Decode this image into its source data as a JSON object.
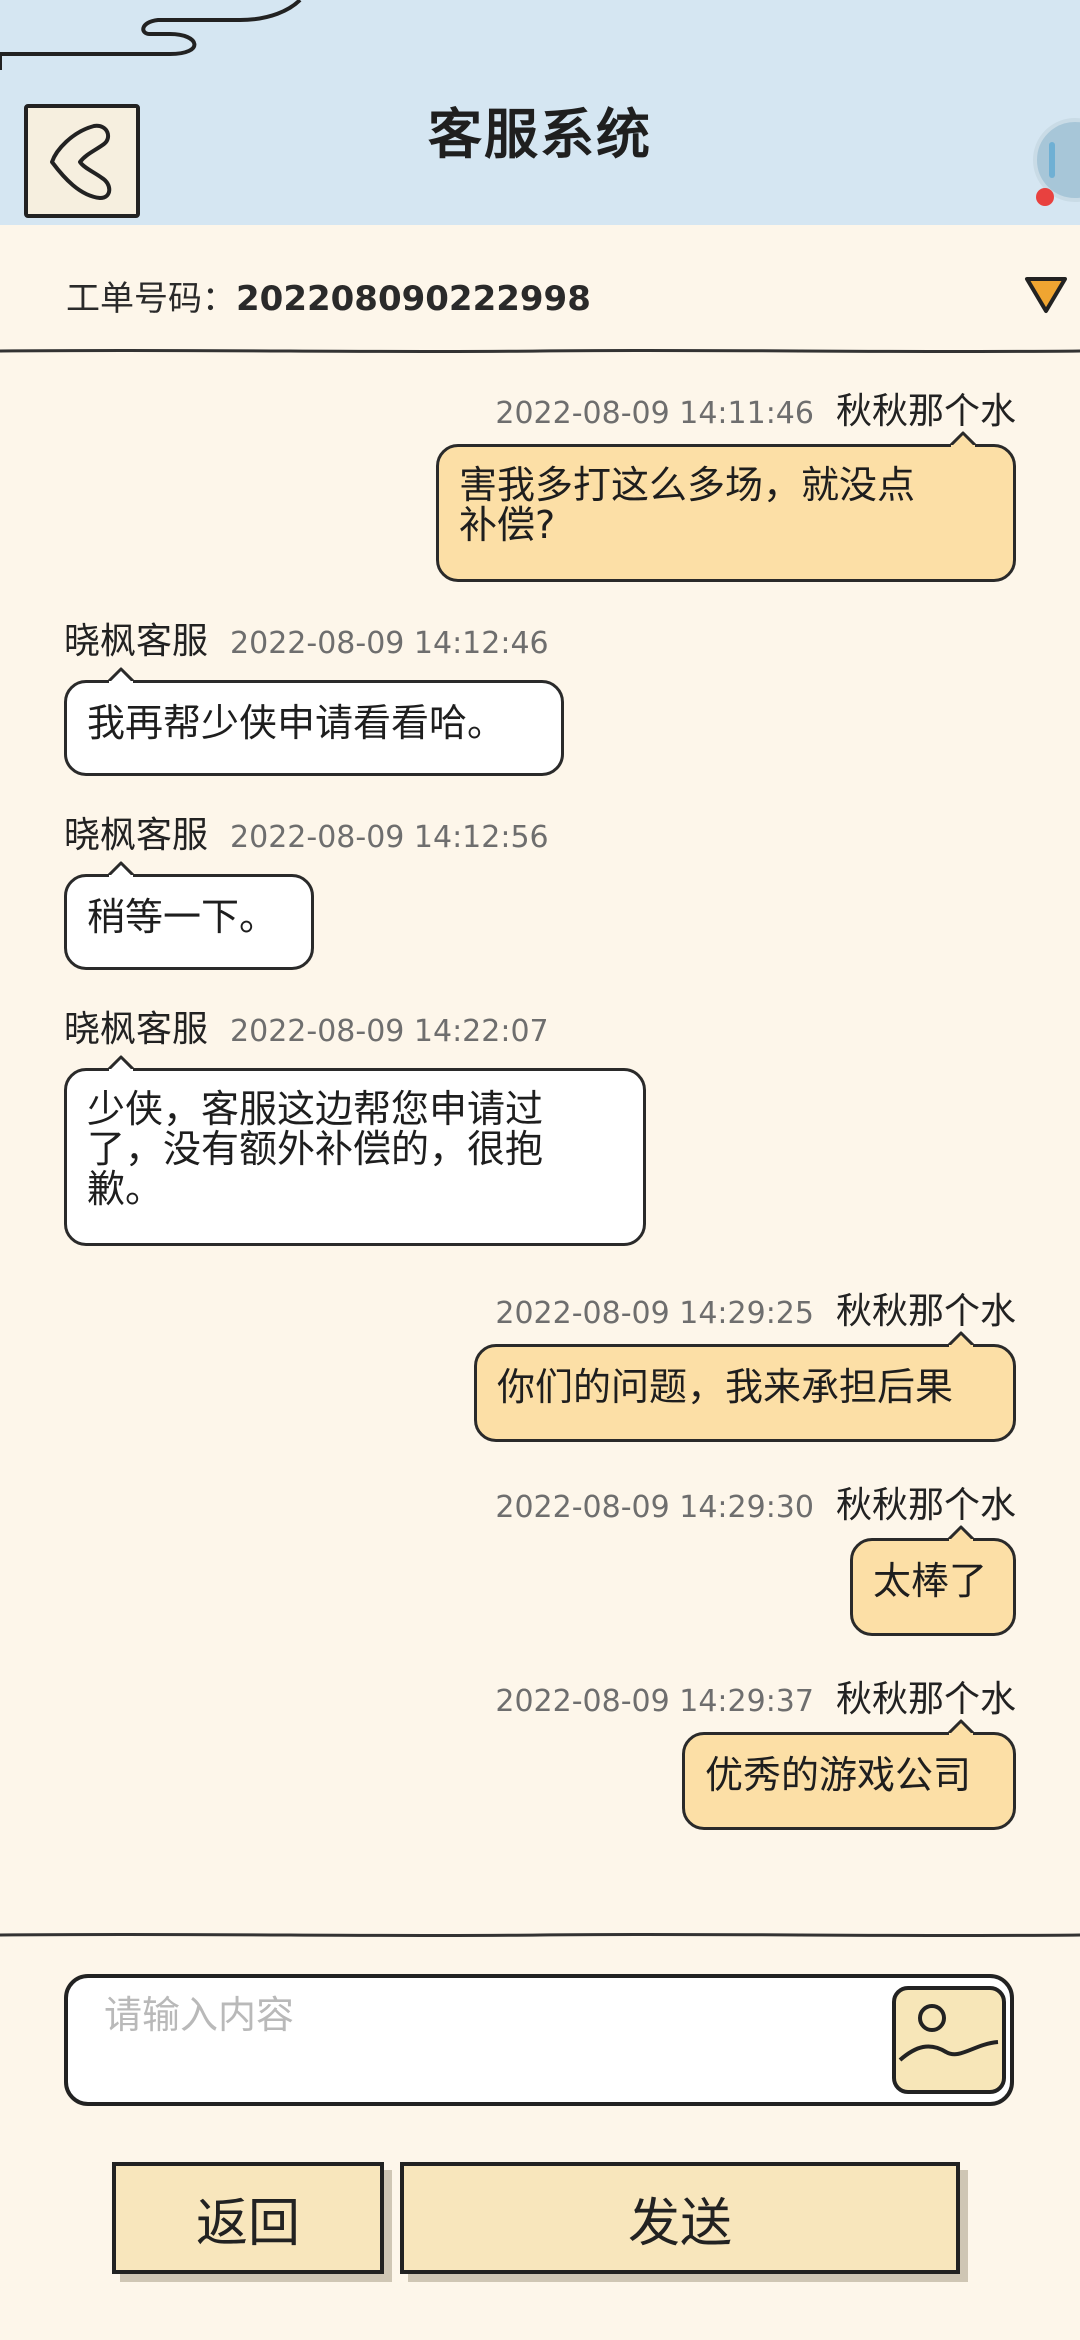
{
  "header": {
    "title": "客服系统",
    "back_icon": "chevron-left-icon",
    "notification_color": "#e8413f"
  },
  "ticket": {
    "label": "工单号码：",
    "number": "202208090222998",
    "dropdown_icon": "triangle-down-icon"
  },
  "messages": [
    {
      "side": "user",
      "name": "秋秋那个水",
      "time": "2022-08-09 14:11:46",
      "lines": [
        "害我多打这么多场，就没点",
        "补偿?"
      ]
    },
    {
      "side": "agent",
      "name": "晓枫客服",
      "time": "2022-08-09 14:12:46",
      "lines": [
        "我再帮少侠申请看看哈。"
      ]
    },
    {
      "side": "agent",
      "name": "晓枫客服",
      "time": "2022-08-09 14:12:56",
      "lines": [
        "稍等一下。"
      ]
    },
    {
      "side": "agent",
      "name": "晓枫客服",
      "time": "2022-08-09 14:22:07",
      "lines": [
        "少侠，客服这边帮您申请过",
        "了，没有额外补偿的，很抱",
        "歉。"
      ]
    },
    {
      "side": "user",
      "name": "秋秋那个水",
      "time": "2022-08-09 14:29:25",
      "lines": [
        "你们的问题，我来承担后果"
      ]
    },
    {
      "side": "user",
      "name": "秋秋那个水",
      "time": "2022-08-09 14:29:30",
      "lines": [
        "太棒了"
      ]
    },
    {
      "side": "user",
      "name": "秋秋那个水",
      "time": "2022-08-09 14:29:37",
      "lines": [
        "优秀的游戏公司"
      ]
    }
  ],
  "input": {
    "placeholder": "请输入内容",
    "value": "",
    "image_icon": "image-icon"
  },
  "buttons": {
    "back_label": "返回",
    "send_label": "发送"
  },
  "colors": {
    "user_bubble": "#fcdfa6",
    "agent_bubble": "#ffffff",
    "header_bg": "#d5e6f2",
    "page_bg": "#fdf6ea",
    "button_bg": "#f8e6bc"
  }
}
